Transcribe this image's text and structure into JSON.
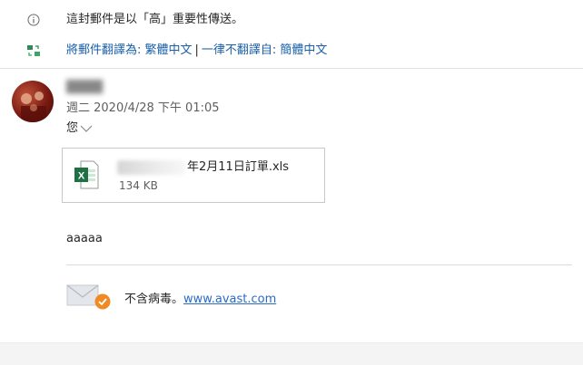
{
  "notices": {
    "importance_text": "這封郵件是以「高」重要性傳送。",
    "translate_link": "將郵件翻譯為: 繁體中文",
    "separator": "|",
    "never_translate_link": "一律不翻譯自: 簡體中文"
  },
  "message": {
    "date": "週二 2020/4/28 下午 01:05",
    "recipient": "您"
  },
  "attachment": {
    "name_suffix": "年2月11日訂單.xls",
    "size": "134 KB",
    "icon": "excel-file-icon"
  },
  "body": {
    "text": "aaaaa"
  },
  "signature": {
    "text": "不含病毒。",
    "link": "www.avast.com",
    "icon": "avast-mail-icon"
  },
  "colors": {
    "link": "#1a5fa8",
    "excel_green": "#1e7145",
    "avast_orange": "#f08a24"
  }
}
